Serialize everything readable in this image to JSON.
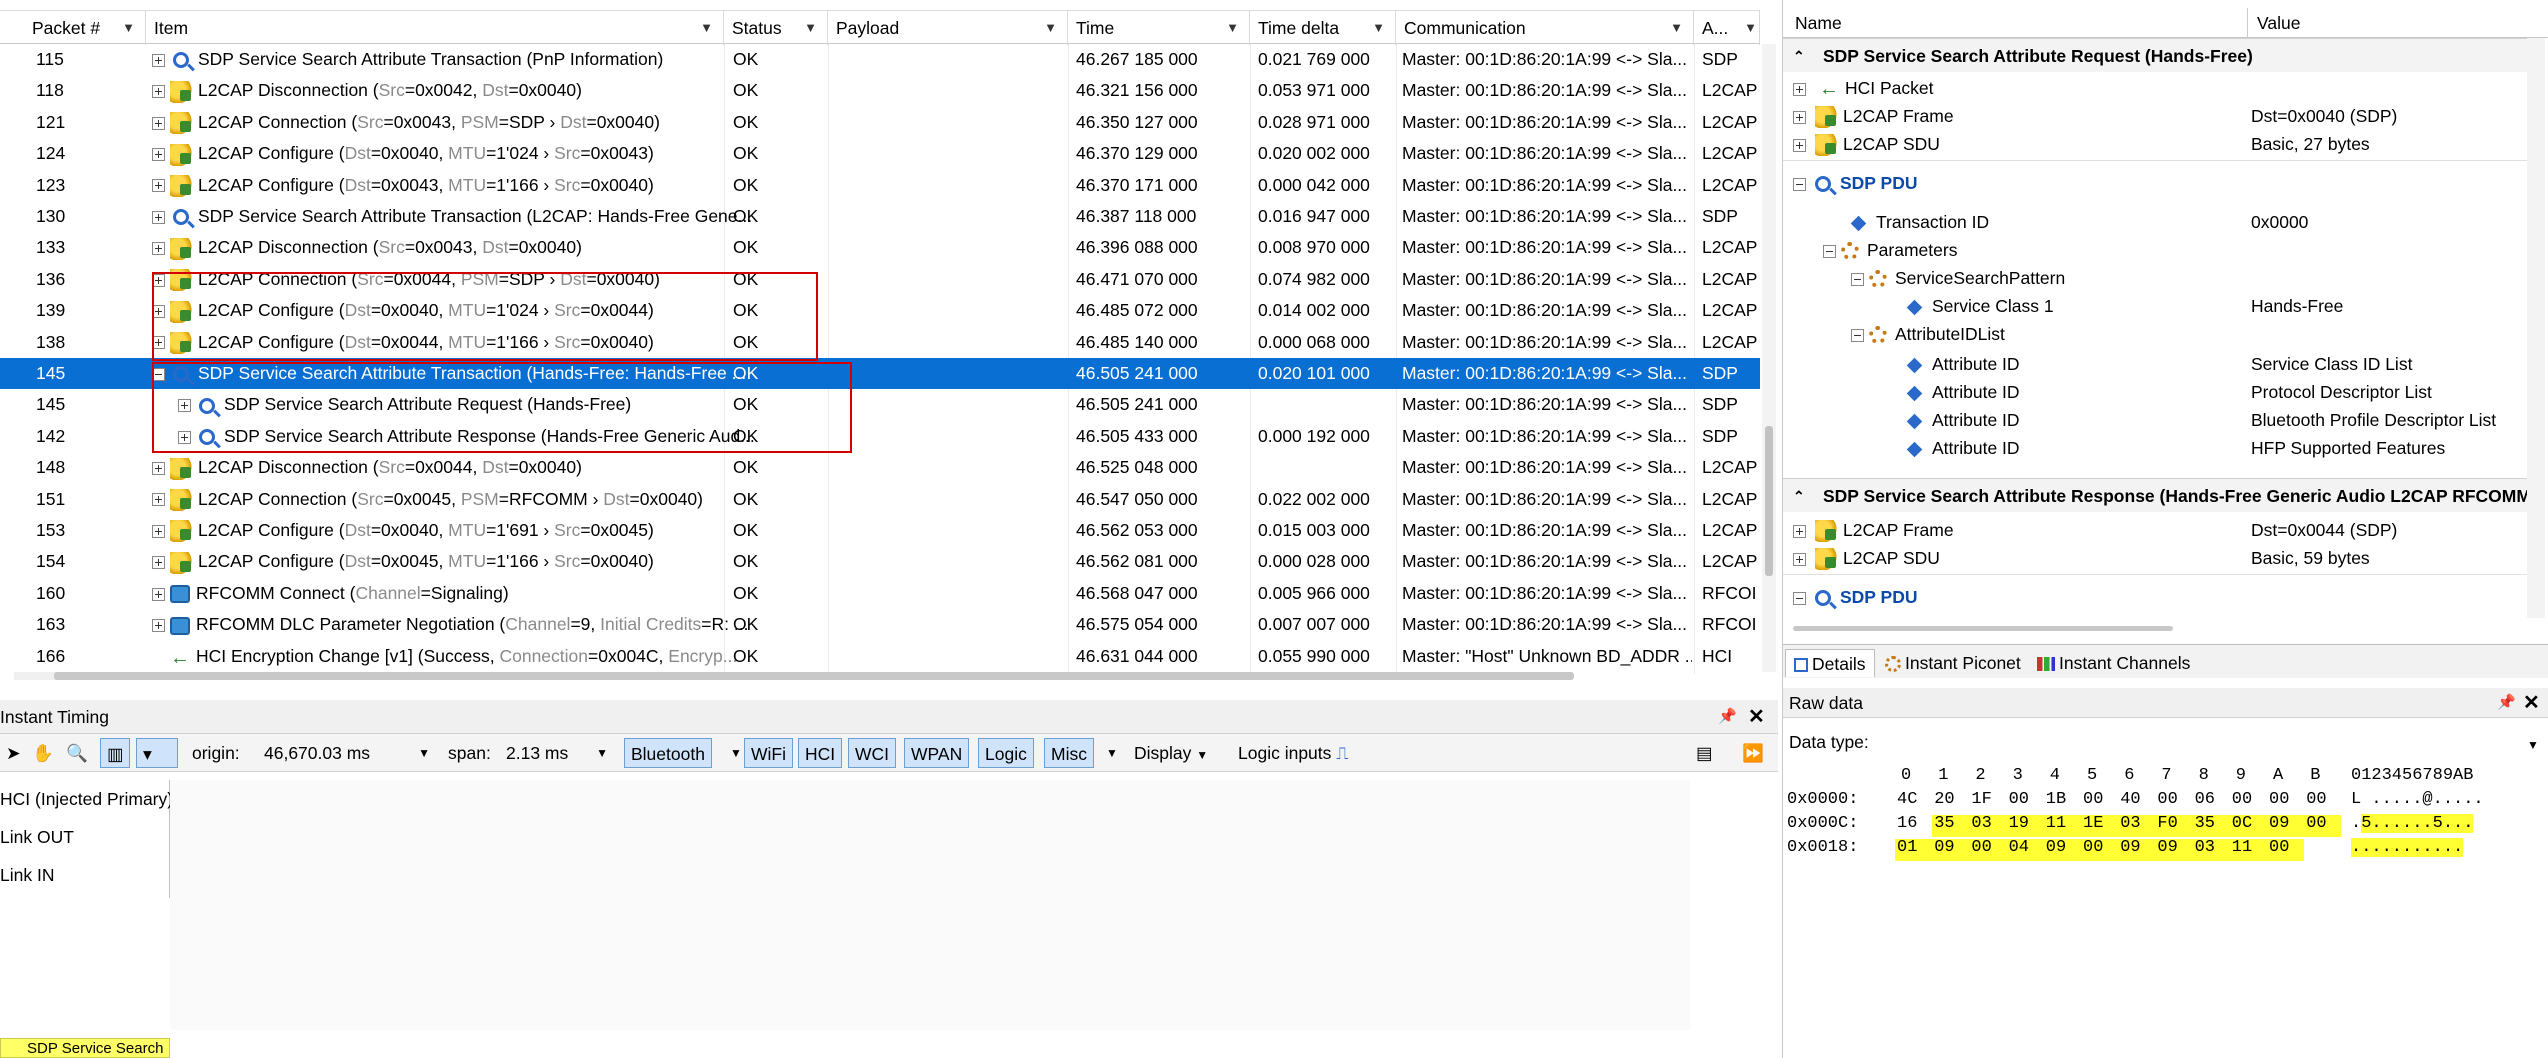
{
  "packet_list": {
    "columns": [
      "Packet #",
      "Item",
      "Status",
      "Payload",
      "Time",
      "Time delta",
      "Communication",
      "A..."
    ],
    "rows": [
      {
        "packet": "115",
        "indent": 0,
        "icon": "sdp",
        "parts": [
          [
            "n",
            "SDP Service Search Attribute Transaction (PnP Information)"
          ]
        ],
        "status": "OK",
        "time": "46.267 185 000",
        "delta": "0.021 769 000",
        "comm": "Master: 00:1D:86:20:1A:99 <-> Sla...",
        "proto": "SDP"
      },
      {
        "packet": "118",
        "indent": 0,
        "icon": "l2cap",
        "parts": [
          [
            "n",
            "L2CAP Disconnection ("
          ],
          [
            "g",
            "Src"
          ],
          [
            "n",
            "=0x0042, "
          ],
          [
            "g",
            "Dst"
          ],
          [
            "n",
            "=0x0040)"
          ]
        ],
        "status": "OK",
        "time": "46.321 156 000",
        "delta": "0.053 971 000",
        "comm": "Master: 00:1D:86:20:1A:99 <-> Sla...",
        "proto": "L2CAP"
      },
      {
        "packet": "121",
        "indent": 0,
        "icon": "l2cap",
        "parts": [
          [
            "n",
            "L2CAP Connection ("
          ],
          [
            "g",
            "Src"
          ],
          [
            "n",
            "=0x0043, "
          ],
          [
            "g",
            "PSM"
          ],
          [
            "n",
            "=SDP › "
          ],
          [
            "g",
            "Dst"
          ],
          [
            "n",
            "=0x0040)"
          ]
        ],
        "status": "OK",
        "time": "46.350 127 000",
        "delta": "0.028 971 000",
        "comm": "Master: 00:1D:86:20:1A:99 <-> Sla...",
        "proto": "L2CAP"
      },
      {
        "packet": "124",
        "indent": 0,
        "icon": "l2cap",
        "parts": [
          [
            "n",
            "L2CAP Configure ("
          ],
          [
            "g",
            "Dst"
          ],
          [
            "n",
            "=0x0040, "
          ],
          [
            "g",
            "MTU"
          ],
          [
            "n",
            "=1'024 › "
          ],
          [
            "g",
            "Src"
          ],
          [
            "n",
            "=0x0043)"
          ]
        ],
        "status": "OK",
        "time": "46.370 129 000",
        "delta": "0.020 002 000",
        "comm": "Master: 00:1D:86:20:1A:99 <-> Sla...",
        "proto": "L2CAP"
      },
      {
        "packet": "123",
        "indent": 0,
        "icon": "l2cap",
        "parts": [
          [
            "n",
            "L2CAP Configure ("
          ],
          [
            "g",
            "Dst"
          ],
          [
            "n",
            "=0x0043, "
          ],
          [
            "g",
            "MTU"
          ],
          [
            "n",
            "=1'166 › "
          ],
          [
            "g",
            "Src"
          ],
          [
            "n",
            "=0x0040)"
          ]
        ],
        "status": "OK",
        "time": "46.370 171 000",
        "delta": "0.000 042 000",
        "comm": "Master: 00:1D:86:20:1A:99 <-> Sla...",
        "proto": "L2CAP"
      },
      {
        "packet": "130",
        "indent": 0,
        "icon": "sdp",
        "parts": [
          [
            "n",
            "SDP Service Search Attribute Transaction (L2CAP: Hands-Free Gene..."
          ]
        ],
        "status": "OK",
        "time": "46.387 118 000",
        "delta": "0.016 947 000",
        "comm": "Master: 00:1D:86:20:1A:99 <-> Sla...",
        "proto": "SDP"
      },
      {
        "packet": "133",
        "indent": 0,
        "icon": "l2cap",
        "parts": [
          [
            "n",
            "L2CAP Disconnection ("
          ],
          [
            "g",
            "Src"
          ],
          [
            "n",
            "=0x0043, "
          ],
          [
            "g",
            "Dst"
          ],
          [
            "n",
            "=0x0040)"
          ]
        ],
        "status": "OK",
        "time": "46.396 088 000",
        "delta": "0.008 970 000",
        "comm": "Master: 00:1D:86:20:1A:99 <-> Sla...",
        "proto": "L2CAP"
      },
      {
        "packet": "136",
        "indent": 0,
        "icon": "l2cap",
        "parts": [
          [
            "n",
            "L2CAP Connection ("
          ],
          [
            "g",
            "Src"
          ],
          [
            "n",
            "=0x0044, "
          ],
          [
            "g",
            "PSM"
          ],
          [
            "n",
            "=SDP › "
          ],
          [
            "g",
            "Dst"
          ],
          [
            "n",
            "=0x0040)"
          ]
        ],
        "status": "OK",
        "time": "46.471 070 000",
        "delta": "0.074 982 000",
        "comm": "Master: 00:1D:86:20:1A:99 <-> Sla...",
        "proto": "L2CAP"
      },
      {
        "packet": "139",
        "indent": 0,
        "icon": "l2cap",
        "parts": [
          [
            "n",
            "L2CAP Configure ("
          ],
          [
            "g",
            "Dst"
          ],
          [
            "n",
            "=0x0040, "
          ],
          [
            "g",
            "MTU"
          ],
          [
            "n",
            "=1'024 › "
          ],
          [
            "g",
            "Src"
          ],
          [
            "n",
            "=0x0044)"
          ]
        ],
        "status": "OK",
        "time": "46.485 072 000",
        "delta": "0.014 002 000",
        "comm": "Master: 00:1D:86:20:1A:99 <-> Sla...",
        "proto": "L2CAP"
      },
      {
        "packet": "138",
        "indent": 0,
        "icon": "l2cap",
        "parts": [
          [
            "n",
            "L2CAP Configure ("
          ],
          [
            "g",
            "Dst"
          ],
          [
            "n",
            "=0x0044, "
          ],
          [
            "g",
            "MTU"
          ],
          [
            "n",
            "=1'166 › "
          ],
          [
            "g",
            "Src"
          ],
          [
            "n",
            "=0x0040)"
          ]
        ],
        "status": "OK",
        "time": "46.485 140 000",
        "delta": "0.000 068 000",
        "comm": "Master: 00:1D:86:20:1A:99 <-> Sla...",
        "proto": "L2CAP"
      },
      {
        "packet": "145",
        "indent": 0,
        "icon": "sdp",
        "expanded": true,
        "selected": true,
        "parts": [
          [
            "n",
            "SDP Service Search Attribute Transaction (Hands-Free: Hands-Free ..."
          ]
        ],
        "status": "OK",
        "time": "46.505 241 000",
        "delta": "0.020 101 000",
        "comm": "Master: 00:1D:86:20:1A:99 <-> Sla...",
        "proto": "SDP"
      },
      {
        "packet": "145",
        "indent": 1,
        "icon": "sdp",
        "parts": [
          [
            "n",
            "SDP Service Search Attribute Request (Hands-Free)"
          ]
        ],
        "status": "OK",
        "time": "46.505 241 000",
        "delta": "",
        "comm": "Master: 00:1D:86:20:1A:99 <-> Sla...",
        "proto": "SDP"
      },
      {
        "packet": "142",
        "indent": 1,
        "icon": "sdp",
        "parts": [
          [
            "n",
            "SDP Service Search Attribute Response (Hands-Free Generic Aud..."
          ]
        ],
        "status": "OK",
        "time": "46.505 433 000",
        "delta": "0.000 192 000",
        "comm": "Master: 00:1D:86:20:1A:99 <-> Sla...",
        "proto": "SDP"
      },
      {
        "packet": "148",
        "indent": 0,
        "icon": "l2cap",
        "parts": [
          [
            "n",
            "L2CAP Disconnection ("
          ],
          [
            "g",
            "Src"
          ],
          [
            "n",
            "=0x0044, "
          ],
          [
            "g",
            "Dst"
          ],
          [
            "n",
            "=0x0040)"
          ]
        ],
        "status": "OK",
        "time": "46.525 048 000",
        "delta": "",
        "comm": "Master: 00:1D:86:20:1A:99 <-> Sla...",
        "proto": "L2CAP"
      },
      {
        "packet": "151",
        "indent": 0,
        "icon": "l2cap",
        "parts": [
          [
            "n",
            "L2CAP Connection ("
          ],
          [
            "g",
            "Src"
          ],
          [
            "n",
            "=0x0045, "
          ],
          [
            "g",
            "PSM"
          ],
          [
            "n",
            "=RFCOMM › "
          ],
          [
            "g",
            "Dst"
          ],
          [
            "n",
            "=0x0040)"
          ]
        ],
        "status": "OK",
        "time": "46.547 050 000",
        "delta": "0.022 002 000",
        "comm": "Master: 00:1D:86:20:1A:99 <-> Sla...",
        "proto": "L2CAP"
      },
      {
        "packet": "153",
        "indent": 0,
        "icon": "l2cap",
        "parts": [
          [
            "n",
            "L2CAP Configure ("
          ],
          [
            "g",
            "Dst"
          ],
          [
            "n",
            "=0x0040, "
          ],
          [
            "g",
            "MTU"
          ],
          [
            "n",
            "=1'691 › "
          ],
          [
            "g",
            "Src"
          ],
          [
            "n",
            "=0x0045)"
          ]
        ],
        "status": "OK",
        "time": "46.562 053 000",
        "delta": "0.015 003 000",
        "comm": "Master: 00:1D:86:20:1A:99 <-> Sla...",
        "proto": "L2CAP"
      },
      {
        "packet": "154",
        "indent": 0,
        "icon": "l2cap",
        "parts": [
          [
            "n",
            "L2CAP Configure ("
          ],
          [
            "g",
            "Dst"
          ],
          [
            "n",
            "=0x0045, "
          ],
          [
            "g",
            "MTU"
          ],
          [
            "n",
            "=1'166 › "
          ],
          [
            "g",
            "Src"
          ],
          [
            "n",
            "=0x0040)"
          ]
        ],
        "status": "OK",
        "time": "46.562 081 000",
        "delta": "0.000 028 000",
        "comm": "Master: 00:1D:86:20:1A:99 <-> Sla...",
        "proto": "L2CAP"
      },
      {
        "packet": "160",
        "indent": 0,
        "icon": "rfcomm",
        "parts": [
          [
            "n",
            "RFCOMM Connect ("
          ],
          [
            "g",
            "Channel"
          ],
          [
            "n",
            "=Signaling)"
          ]
        ],
        "status": "OK",
        "time": "46.568 047 000",
        "delta": "0.005 966 000",
        "comm": "Master: 00:1D:86:20:1A:99 <-> Sla...",
        "proto": "RFCOI"
      },
      {
        "packet": "163",
        "indent": 0,
        "icon": "rfcomm",
        "parts": [
          [
            "n",
            "RFCOMM DLC Parameter Negotiation ("
          ],
          [
            "g",
            "Channel"
          ],
          [
            "n",
            "=9, "
          ],
          [
            "g",
            "Initial Credits"
          ],
          [
            "n",
            "=R: ..."
          ]
        ],
        "status": "OK",
        "time": "46.575 054 000",
        "delta": "0.007 007 000",
        "comm": "Master: 00:1D:86:20:1A:99 <-> Sla...",
        "proto": "RFCOI"
      },
      {
        "packet": "166",
        "indent": 0,
        "icon": "hci",
        "noexpand": true,
        "parts": [
          [
            "n",
            "HCI Encryption Change [v1] (Success, "
          ],
          [
            "g",
            "Connection"
          ],
          [
            "n",
            "=0x004C, "
          ],
          [
            "g",
            "Encryp..."
          ]
        ],
        "status": "OK",
        "time": "46.631 044 000",
        "delta": "0.055 990 000",
        "comm": "Master: \"Host\" Unknown BD_ADDR ...",
        "proto": "HCI"
      }
    ]
  },
  "details": {
    "col_name": "Name",
    "col_value": "Value",
    "request_title": "SDP Service Search Attribute Request (Hands-Free)",
    "hci_packet": "HCI Packet",
    "l2cap_frame": "L2CAP Frame",
    "l2cap_frame_value": "Dst=0x0040 (SDP)",
    "l2cap_sdu": "L2CAP SDU",
    "l2cap_sdu_value": "Basic, 27 bytes",
    "sdp_pdu": "SDP PDU",
    "transaction_id": "Transaction ID",
    "transaction_id_value": "0x0000",
    "parameters": "Parameters",
    "service_search_pattern": "ServiceSearchPattern",
    "service_class": "Service Class 1",
    "service_class_value": "Hands-Free",
    "attribute_id_list": "AttributeIDList",
    "attribute_id": "Attribute ID",
    "attr_values": [
      "Service Class ID List",
      "Protocol Descriptor List",
      "Bluetooth Profile Descriptor List",
      "HFP Supported Features"
    ],
    "response_title": "SDP Service Search Attribute Response (Hands-Free Generic Audio L2CAP RFCOMM (",
    "resp_l2cap_frame_value": "Dst=0x0044 (SDP)",
    "resp_l2cap_sdu_value": "Basic, 59 bytes",
    "tabs": [
      "Details",
      "Instant Piconet",
      "Instant Channels"
    ]
  },
  "timing": {
    "title": "Instant Timing",
    "origin_label": "origin:",
    "origin_value": "46,670.03 ms",
    "span_label": "span:",
    "span_value": "2.13 ms",
    "filters": [
      "Bluetooth",
      "WiFi",
      "HCI",
      "WCI",
      "WPAN",
      "Logic",
      "Misc"
    ],
    "display": "Display",
    "logic_inputs": "Logic inputs",
    "lanes": [
      "HCI (Injected Primary)",
      "Link OUT",
      "Link IN"
    ],
    "status_label": "SDP Service Search"
  },
  "raw": {
    "title": "Raw data",
    "data_type_label": "Data type:",
    "hex_header": [
      "0",
      "1",
      "2",
      "3",
      "4",
      "5",
      "6",
      "7",
      "8",
      "9",
      "A",
      "B"
    ],
    "ascii_header": "0123456789AB",
    "lines": [
      {
        "offset": "0x0000:",
        "bytes": [
          "4C",
          "20",
          "1F",
          "00",
          "1B",
          "00",
          "40",
          "00",
          "06",
          "00",
          "00",
          "00"
        ],
        "hl_from": 12,
        "ascii": "L .....@....."
      },
      {
        "offset": "0x000C:",
        "bytes": [
          "16",
          "35",
          "03",
          "19",
          "11",
          "1E",
          "03",
          "F0",
          "35",
          "0C",
          "09",
          "00"
        ],
        "hl_from": 1,
        "ascii": ".5......5..."
      },
      {
        "offset": "0x0018:",
        "bytes": [
          "01",
          "09",
          "00",
          "04",
          "09",
          "00",
          "09",
          "09",
          "03",
          "11",
          "00"
        ],
        "hl_from": 0,
        "ascii": "..........."
      }
    ]
  }
}
